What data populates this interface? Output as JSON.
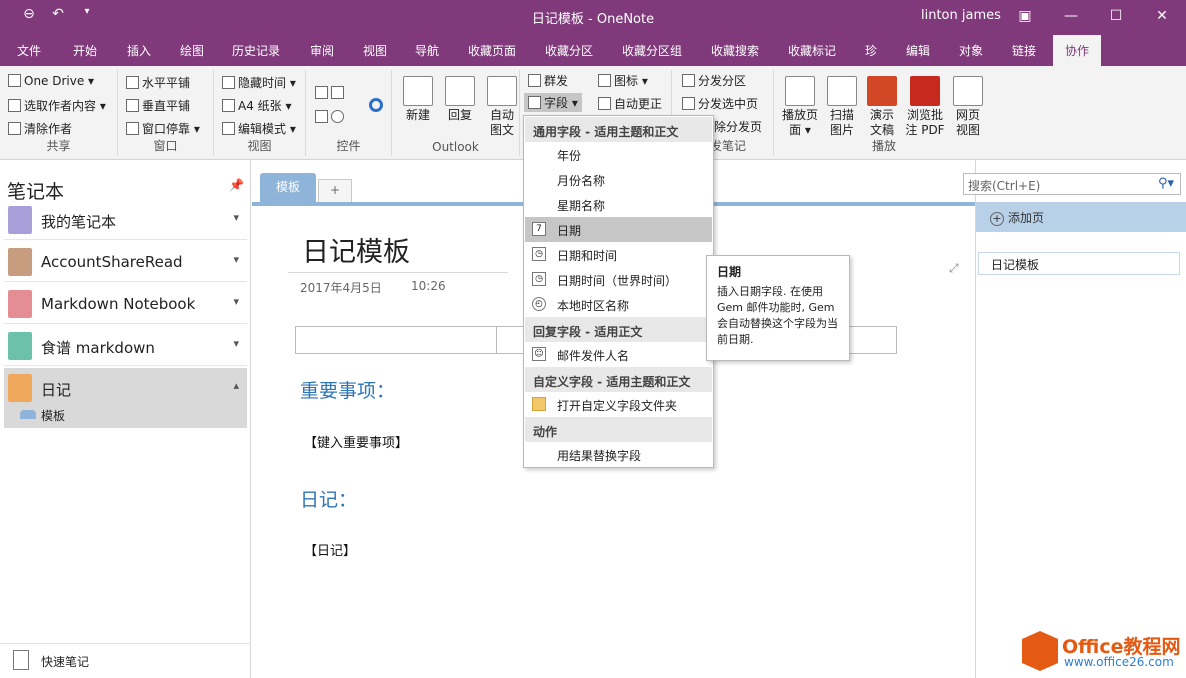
{
  "titlebar": {
    "title": "日记模板 - OneNote",
    "user": "linton james",
    "back_icon": "back-icon",
    "undo_icon": "undo-icon"
  },
  "ribbon_tabs": [
    "文件",
    "开始",
    "插入",
    "绘图",
    "历史记录",
    "审阅",
    "视图",
    "导航",
    "收藏页面",
    "收藏分区",
    "收藏分区组",
    "收藏搜索",
    "收藏标记",
    "珍",
    "编辑",
    "对象",
    "链接",
    "协作"
  ],
  "active_tab": "协作",
  "ribbon": {
    "share": {
      "label": "共享",
      "items": [
        "One Drive ▾",
        "选取作者内容 ▾",
        "清除作者"
      ]
    },
    "window": {
      "label": "窗口",
      "items": [
        "水平平铺",
        "垂直平铺",
        "窗口停靠 ▾"
      ]
    },
    "view": {
      "label": "视图",
      "items": [
        "隐藏时间 ▾",
        "A4 纸张 ▾",
        "编辑模式 ▾"
      ]
    },
    "controls": {
      "label": "控件"
    },
    "outlook": {
      "label": "Outlook",
      "items": [
        "新建",
        "回复",
        "自动\n图文"
      ]
    },
    "fields": {
      "group": "群发",
      "field": "字段 ▾",
      "icons": "图标 ▾",
      "auto": "自动更正",
      "send_section": "分发分区",
      "send_selected": "分发选中页",
      "send_del": "除分发页",
      "partial_label": "发笔记"
    },
    "play": {
      "label": "播放",
      "items": [
        "播放页\n面 ▾",
        "扫描\n图片",
        "演示\n文稿",
        "浏览批\n注 PDF",
        "网页\n视图"
      ]
    }
  },
  "left": {
    "header": "笔记本",
    "notebooks": [
      {
        "name": "我的笔记本",
        "color": "#a99fd8"
      },
      {
        "name": "AccountShareRead",
        "color": "#c79c7f"
      },
      {
        "name": "Markdown Notebook",
        "color": "#e58d95"
      },
      {
        "name": "食谱 markdown",
        "color": "#6cc1ac"
      },
      {
        "name": "日记",
        "color": "#f0a85c"
      }
    ],
    "section": "模板",
    "quick_notes": "快速笔记"
  },
  "page": {
    "section_tab": "模板",
    "add_tab": "+",
    "title": "日记模板",
    "date": "2017年4月5日",
    "time": "10:26",
    "heading1": "重要事项：",
    "body1": "【键入重要事项】",
    "heading2": "日记：",
    "body2": "【日记】"
  },
  "right": {
    "search_placeholder": "搜索(Ctrl+E)",
    "add_page": "添加页",
    "pages": [
      "日记模板"
    ]
  },
  "menu": {
    "h1": "通用字段 - 适用主题和正文",
    "items1": [
      "年份",
      "月份名称",
      "星期名称",
      "日期",
      "日期和时间",
      "日期时间（世界时间）",
      "本地时区名称"
    ],
    "h2": "回复字段 - 适用正文",
    "items2": [
      "邮件发件人名"
    ],
    "h3": "自定义字段 - 适用主题和正文",
    "items3": [
      "打开自定义字段文件夹"
    ],
    "h4": "动作",
    "items4": [
      "用结果替换字段"
    ]
  },
  "tooltip": {
    "title": "日期",
    "text": "插入日期字段. 在使用 Gem 邮件功能时, Gem 会自动替换这个字段为当前日期."
  },
  "watermark": {
    "brand": "Office教程网",
    "url": "www.office26.com"
  }
}
